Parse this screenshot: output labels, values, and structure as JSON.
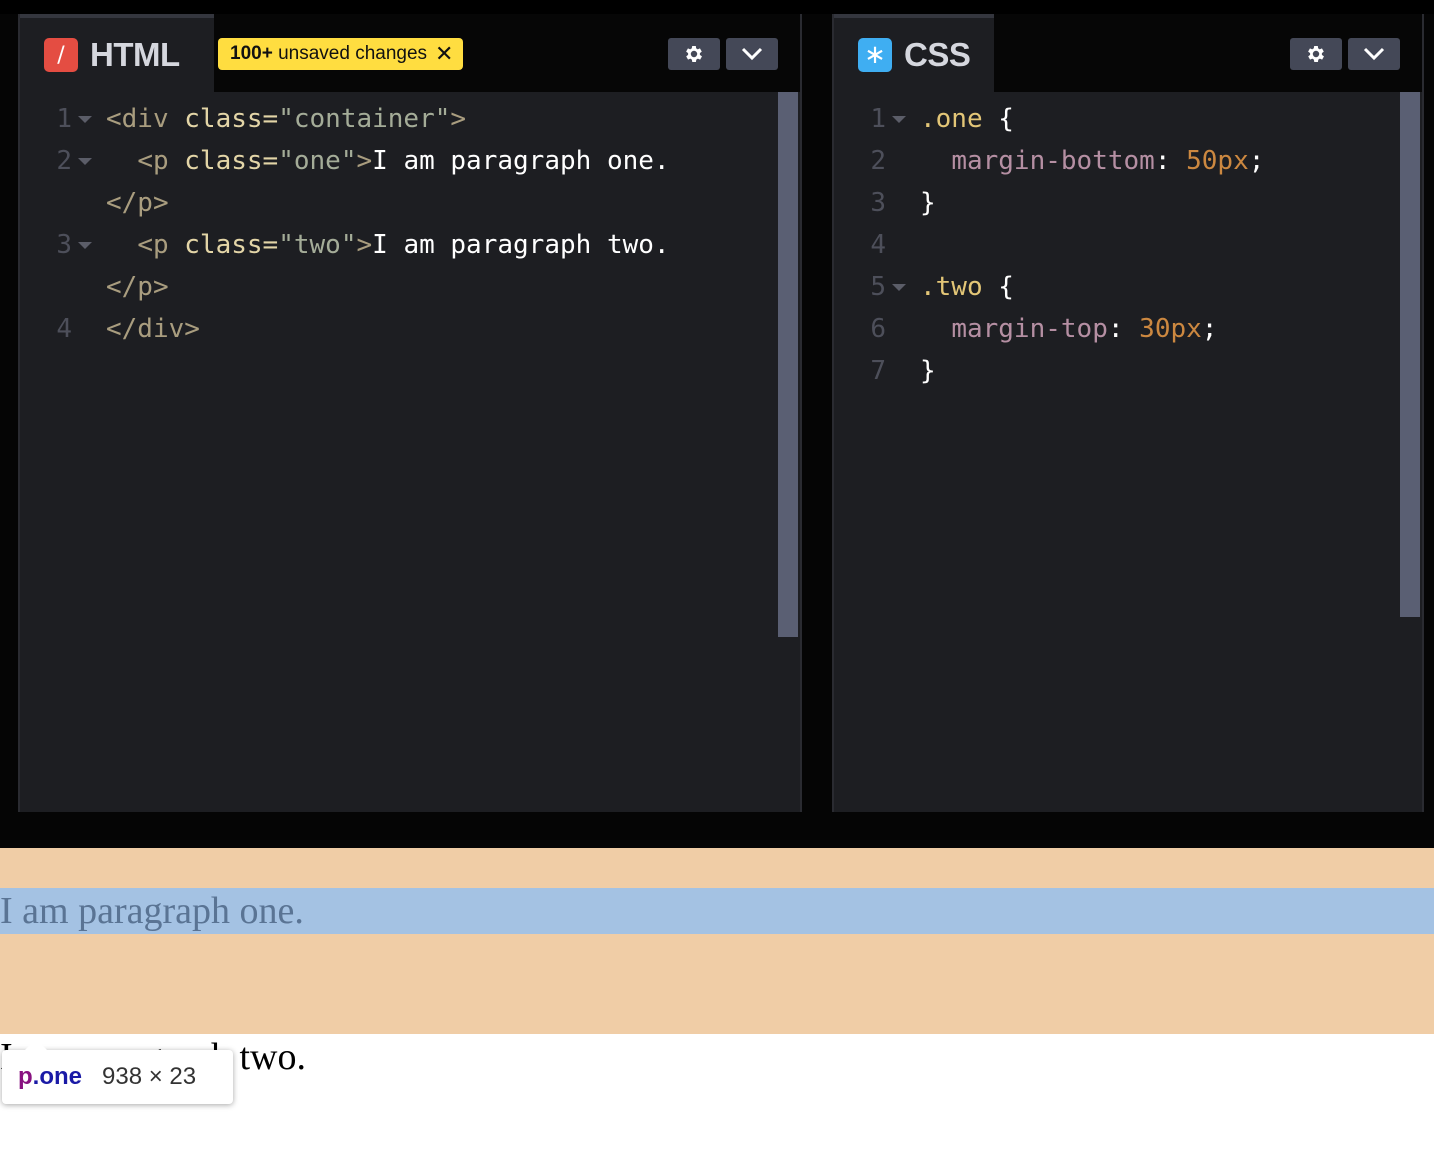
{
  "html_panel": {
    "title": "HTML",
    "icon": "slash-icon",
    "icon_color": "#e44d42",
    "badge": {
      "count": "100+",
      "text": " unsaved changes"
    },
    "lines": [
      {
        "n": "1",
        "fold": true,
        "tokens": [
          [
            "t-tag",
            "<div "
          ],
          [
            "t-attr",
            "class="
          ],
          [
            "t-str",
            "\"container\""
          ],
          [
            "t-tag",
            ">"
          ]
        ]
      },
      {
        "n": "2",
        "fold": true,
        "tokens": [
          [
            "t-txt",
            "  "
          ],
          [
            "t-tag",
            "<p "
          ],
          [
            "t-attr",
            "class="
          ],
          [
            "t-str",
            "\"one\""
          ],
          [
            "t-tag",
            ">"
          ],
          [
            "t-txt",
            "I am paragraph one."
          ]
        ]
      },
      {
        "n": "",
        "fold": false,
        "tokens": [
          [
            "t-tag",
            "</p>"
          ]
        ]
      },
      {
        "n": "3",
        "fold": true,
        "tokens": [
          [
            "t-txt",
            "  "
          ],
          [
            "t-tag",
            "<p "
          ],
          [
            "t-attr",
            "class="
          ],
          [
            "t-str",
            "\"two\""
          ],
          [
            "t-tag",
            ">"
          ],
          [
            "t-txt",
            "I am paragraph two."
          ]
        ]
      },
      {
        "n": "",
        "fold": false,
        "tokens": [
          [
            "t-tag",
            "</p>"
          ]
        ]
      },
      {
        "n": "4",
        "fold": false,
        "tokens": [
          [
            "t-tag",
            "</div>"
          ]
        ]
      }
    ]
  },
  "css_panel": {
    "title": "CSS",
    "icon": "asterisk-icon",
    "icon_color": "#3faef2",
    "lines": [
      {
        "n": "1",
        "fold": true,
        "tokens": [
          [
            "t-sel",
            ".one"
          ],
          [
            "t-brace",
            " {"
          ]
        ]
      },
      {
        "n": "2",
        "fold": false,
        "tokens": [
          [
            "t-txt",
            "  "
          ],
          [
            "t-prop",
            "margin-bottom"
          ],
          [
            "t-punc",
            ": "
          ],
          [
            "t-num",
            "50px"
          ],
          [
            "t-punc",
            ";"
          ]
        ]
      },
      {
        "n": "3",
        "fold": false,
        "tokens": [
          [
            "t-brace",
            "}"
          ]
        ]
      },
      {
        "n": "4",
        "fold": false,
        "tokens": []
      },
      {
        "n": "5",
        "fold": true,
        "tokens": [
          [
            "t-sel",
            ".two"
          ],
          [
            "t-brace",
            " {"
          ]
        ]
      },
      {
        "n": "6",
        "fold": false,
        "tokens": [
          [
            "t-txt",
            "  "
          ],
          [
            "t-prop",
            "margin-top"
          ],
          [
            "t-punc",
            ": "
          ],
          [
            "t-num",
            "30px"
          ],
          [
            "t-punc",
            ";"
          ]
        ]
      },
      {
        "n": "7",
        "fold": false,
        "tokens": [
          [
            "t-brace",
            "}"
          ]
        ]
      }
    ]
  },
  "preview": {
    "para_one": "I am paragraph one.",
    "para_two": "I am paragraph two.",
    "highlight_color": "#a4c2e3",
    "margin_color": "#f0cda6"
  },
  "tooltip": {
    "tag": "p",
    "class_name": ".one",
    "dimensions": "938 × 23"
  }
}
